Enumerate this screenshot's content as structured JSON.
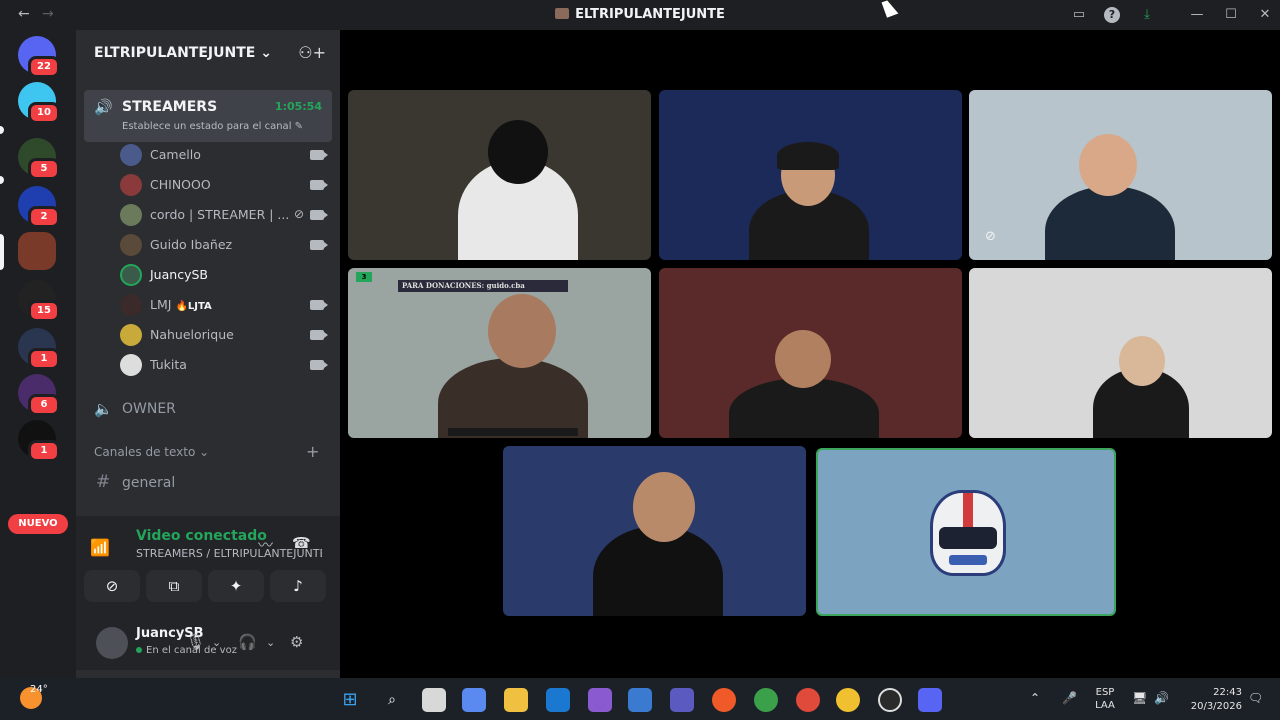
{
  "window": {
    "title": "ELTRIPULANTEJUNTE",
    "back_icon": "arrow-left-icon",
    "forward_icon": "arrow-right-icon",
    "inbox_icon": "inbox-icon",
    "help_icon": "help-icon",
    "download_icon": "download-icon",
    "minimize": "—",
    "maximize": "☐",
    "close": "✕"
  },
  "guilds": [
    {
      "badge": "22",
      "color": "#5865f2"
    },
    {
      "badge": "10",
      "color": "#3ec6f0"
    },
    {
      "badge": "5",
      "color": "#2f4a2a"
    },
    {
      "badge": "2",
      "color": "#1f3fb0"
    },
    {
      "badge": "",
      "color": "#7a3a2a"
    },
    {
      "badge": "15",
      "color": "#222222"
    },
    {
      "badge": "1",
      "color": "#2a3550"
    },
    {
      "badge": "6",
      "color": "#4a2c6a"
    },
    {
      "badge": "1",
      "color": "#111111"
    }
  ],
  "guild_labels": {
    "new_pill": "NUEVO"
  },
  "server": {
    "name": "ELTRIPULANTEJUNTE",
    "chevron": "⌄",
    "invite_icon": "add-member-icon"
  },
  "voice_channel": {
    "name": "STREAMERS",
    "timer": "1:05:54",
    "status": "Establece un estado para el canal",
    "members": [
      {
        "name": "Camello",
        "color": "#4a5a8a",
        "cam": true,
        "mute": false
      },
      {
        "name": "CHINOOO",
        "color": "#8a3a3a",
        "cam": true,
        "mute": false
      },
      {
        "name": "cordo | STREAMER | ...",
        "color": "#6a7a5a",
        "cam": true,
        "mute": true
      },
      {
        "name": "Guido Ibañez",
        "color": "#5a4a3a",
        "cam": true,
        "mute": false
      },
      {
        "name": "JuancySB",
        "color": "#3a5a4a",
        "cam": false,
        "mute": false
      },
      {
        "name": "LMJ",
        "tag": "🔥LJTA",
        "color": "#3a2a2a",
        "cam": true,
        "mute": false
      },
      {
        "name": "Nahuelorique",
        "color": "#c9a93a",
        "cam": true,
        "mute": false
      },
      {
        "name": "Tukita",
        "color": "#dddddd",
        "cam": true,
        "mute": false
      }
    ]
  },
  "owner_channel": {
    "name": "OWNER"
  },
  "text_category": {
    "name": "Canales de texto",
    "chevron": "⌄",
    "plus": "+"
  },
  "text_channel": {
    "hash": "#",
    "name": "general"
  },
  "voice_panel": {
    "status": "Video conectado",
    "channel_path": "STREAMERS / ELTRIPULANTEJUNTE",
    "buttons": [
      "camera-off-icon",
      "screen-share-icon",
      "activities-icon",
      "soundboard-icon"
    ]
  },
  "user": {
    "name": "JuancySB",
    "status": "En el canal de voz"
  },
  "tiles": [
    {
      "bg": "#3a3630",
      "skin": "#b08a70",
      "hair": "#111111",
      "shirt": "#e8e8e8"
    },
    {
      "bg": "#1c2a5a",
      "skin": "#c89a78",
      "hair": "#1a1a1a",
      "shirt": "#1a1a1a"
    },
    {
      "bg": "#b8c4cc",
      "skin": "#d8a888",
      "hair": "#5a4030",
      "shirt": "#1c2a3a"
    },
    {
      "bg": "#9aa4a0",
      "skin": "#a87a60",
      "hair": "#4a4a4a",
      "shirt": "#3a2e28"
    },
    {
      "bg": "#5a2a2a",
      "skin": "#b08060",
      "hair": "#1a1a1a",
      "shirt": "#1a1a1a"
    },
    {
      "bg": "#d8d8d8",
      "skin": "#d8b898",
      "hair": "#5a4030",
      "shirt": "#1a1a1a"
    },
    {
      "bg": "#2a3a6a",
      "skin": "#b88a6a",
      "hair": "#1a1a1a",
      "shirt": "#111111"
    }
  ],
  "tile_texts": {
    "donation_overlay": "PARA DONACIONES: guido.cba",
    "live_tag": "3"
  },
  "taskbar": {
    "weather_temp": "24°",
    "lang_line1": "ESP",
    "lang_line2": "LAA",
    "time": "22:43",
    "date": "20/3/2026"
  }
}
